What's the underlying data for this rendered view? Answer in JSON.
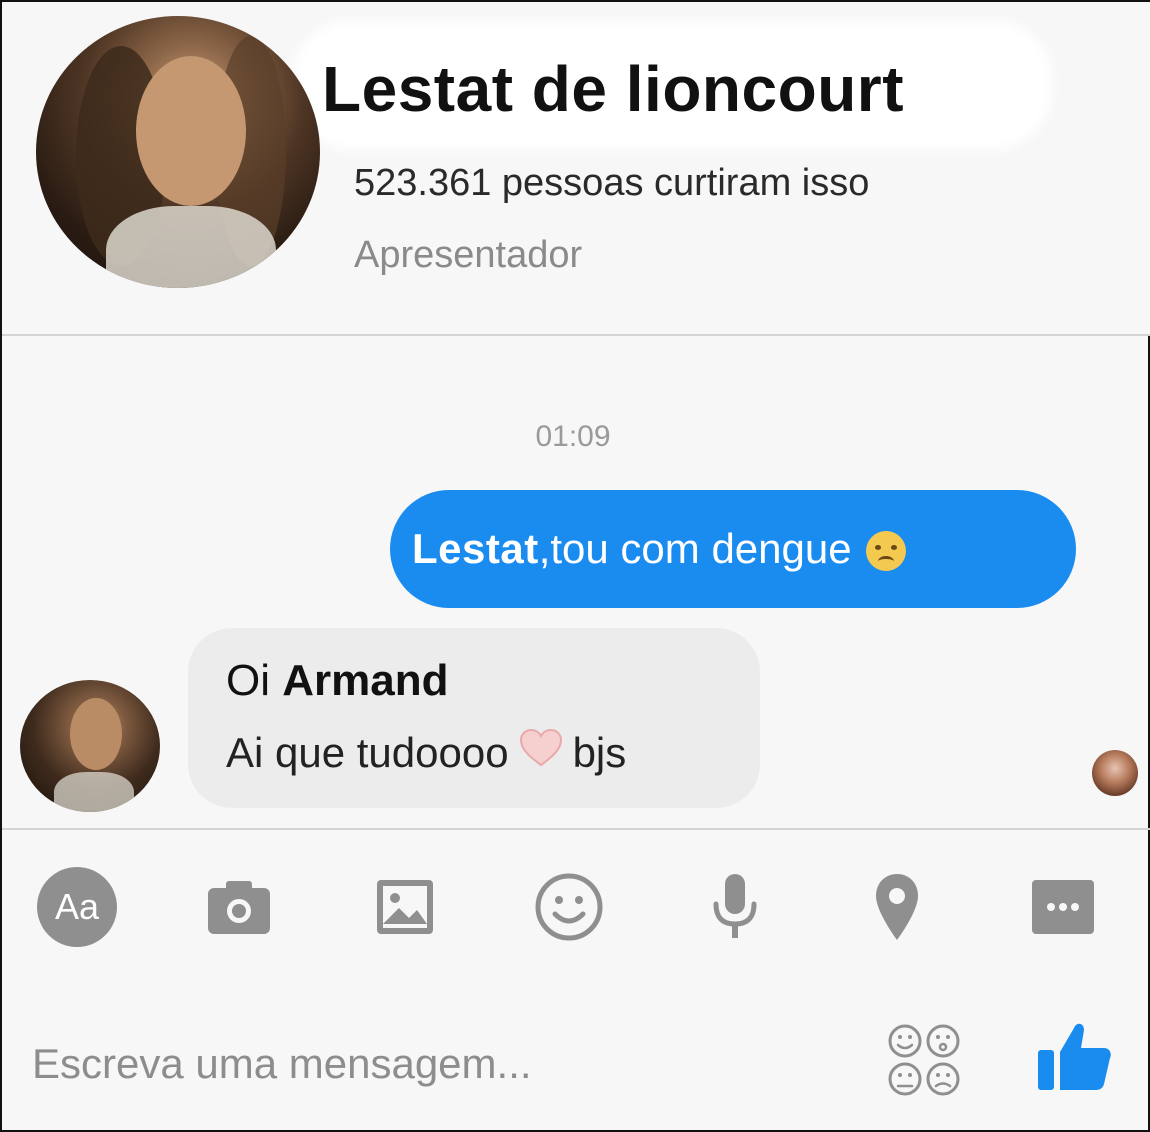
{
  "header": {
    "name": "Lestat de lioncourt",
    "likes": "523.361 pessoas curtiram isso",
    "category": "Apresentador"
  },
  "conversation": {
    "timestamp": "01:09",
    "sent": {
      "part1": "Lestat",
      "part2": " ,tou com dengue"
    },
    "received": {
      "line1_a": "Oi ",
      "line1_b": "Armand",
      "line2_a": "Ai que tudoooo",
      "line2_b": "bjs"
    }
  },
  "toolbar": {
    "aa_label": "Aa",
    "icons": [
      "text-format-icon",
      "camera-icon",
      "image-icon",
      "emoji-icon",
      "microphone-icon",
      "location-icon",
      "more-icon"
    ]
  },
  "composer": {
    "placeholder": "Escreva uma mensagem...",
    "value": ""
  },
  "colors": {
    "accent": "#1a8cf0",
    "icon_gray": "#8f8f8f",
    "bubble_in": "#ececec"
  }
}
